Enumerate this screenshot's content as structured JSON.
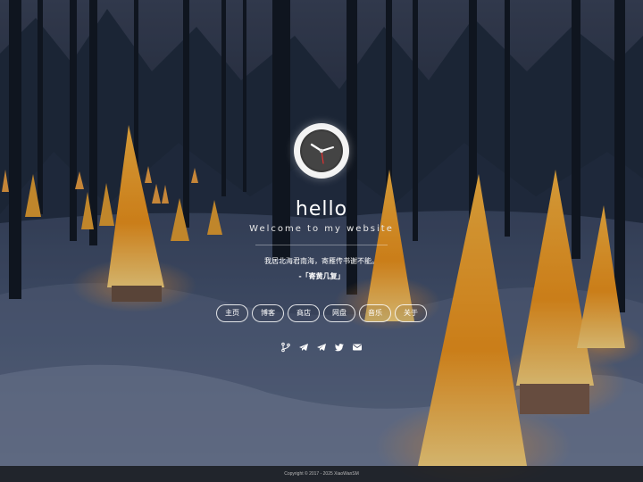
{
  "site": {
    "title": "hello",
    "subtitle": "Welcome to my website",
    "quote": "我居北海君南海，寄雁传书谢不能。",
    "quote_source": "-「寄黄几复」"
  },
  "nav": {
    "items": [
      {
        "label": "主页"
      },
      {
        "label": "博客"
      },
      {
        "label": "商店"
      },
      {
        "label": "网盘"
      },
      {
        "label": "音乐"
      },
      {
        "label": "关于"
      }
    ]
  },
  "social": {
    "icons": [
      "git-icon",
      "telegram-icon",
      "telegram-icon",
      "twitter-icon",
      "mail-icon"
    ]
  },
  "footer": {
    "text": "Copyright © 2017 - 2025 XiaoWanSM"
  },
  "colors": {
    "lantern": "#f5a020",
    "lantern_glow": "#ffd27a",
    "snow": "#c8d2e2",
    "sky": "#1a2438"
  }
}
